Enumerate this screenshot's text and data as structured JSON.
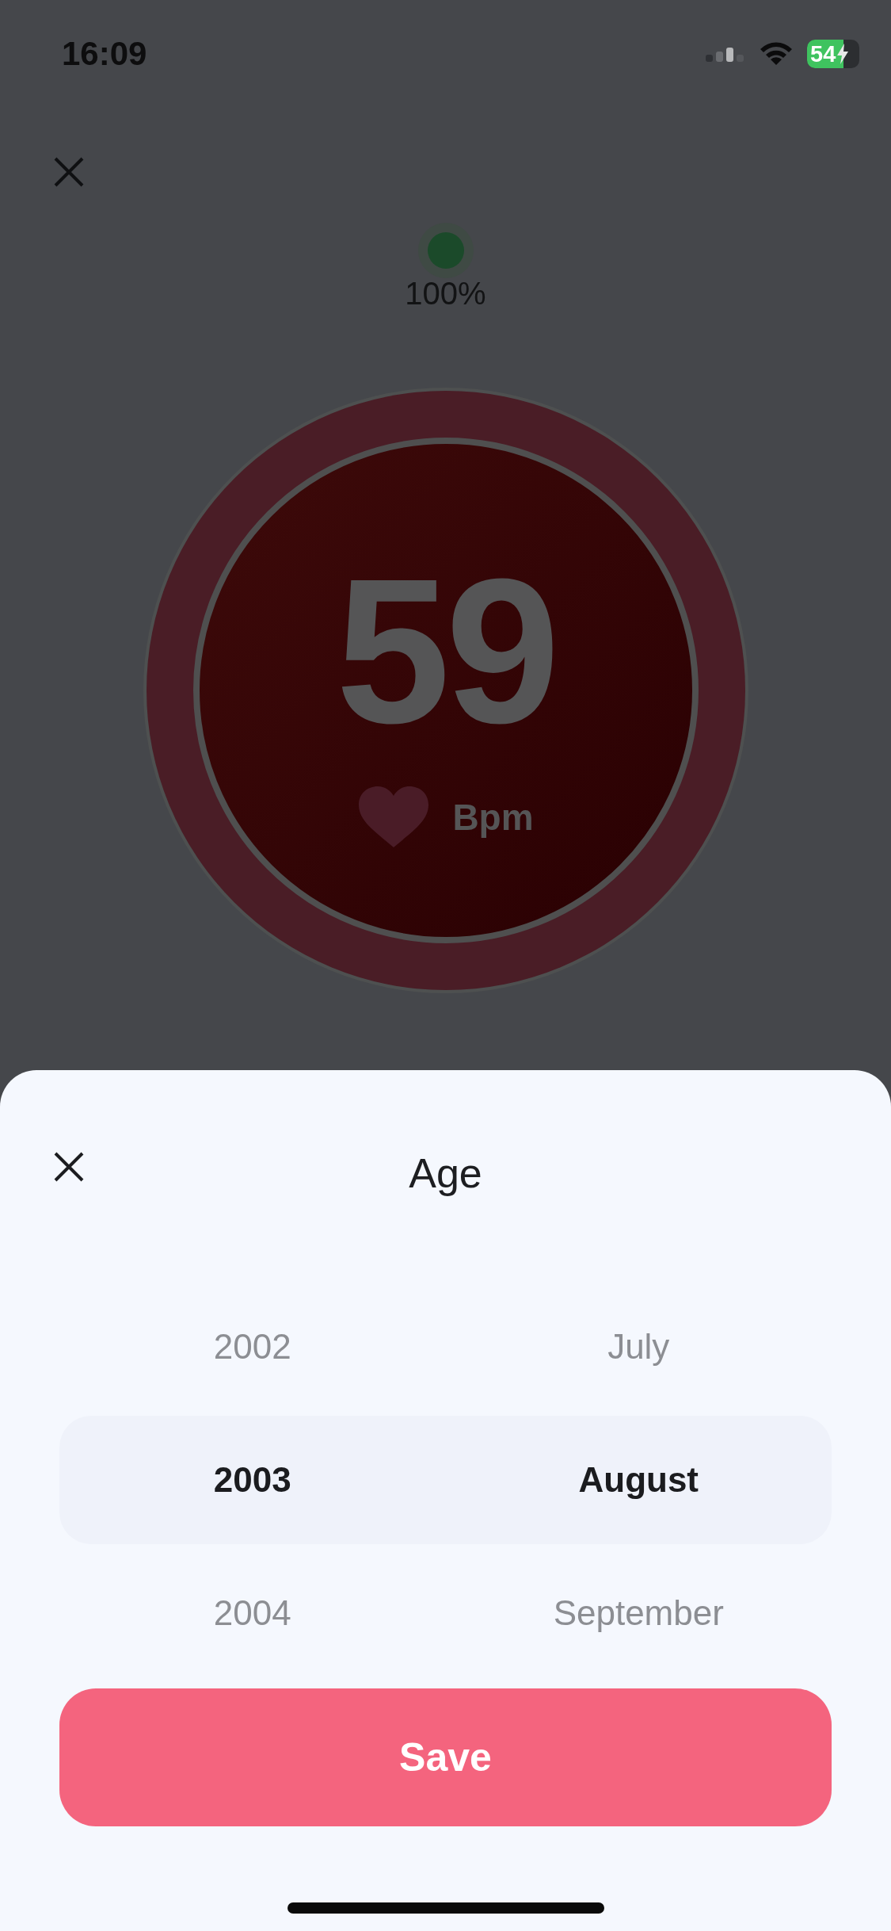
{
  "status_bar": {
    "time": "16:09",
    "battery": "54"
  },
  "device": {
    "battery": "100%"
  },
  "heart_rate": {
    "value": "59",
    "unit": "Bpm"
  },
  "sheet": {
    "title": "Age",
    "picker": {
      "columns": [
        {
          "rows": [
            {
              "label": "2002",
              "selected": false
            },
            {
              "label": "2003",
              "selected": true
            },
            {
              "label": "2004",
              "selected": false
            }
          ]
        },
        {
          "rows": [
            {
              "label": "July",
              "selected": false
            },
            {
              "label": "August",
              "selected": true
            },
            {
              "label": "September",
              "selected": false
            }
          ]
        }
      ]
    },
    "save_button": "Save"
  }
}
